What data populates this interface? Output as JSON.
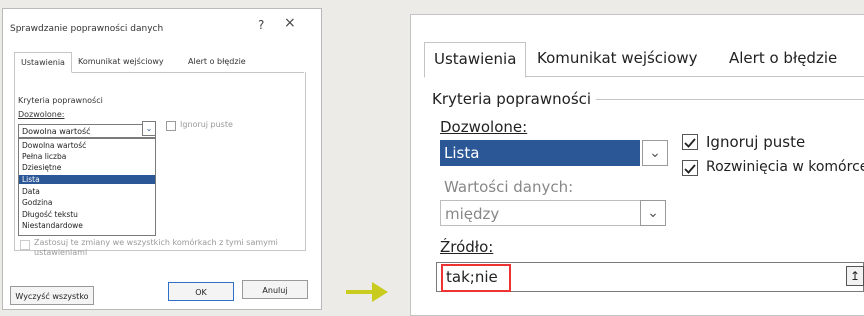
{
  "small_dialog": {
    "title": "Sprawdzanie poprawności danych",
    "help": "?",
    "close": "×",
    "tabs": [
      "Ustawienia",
      "Komunikat wejściowy",
      "Alert o błędzie"
    ],
    "criteria_label": "Kryteria poprawności",
    "allow_label": "Dozwolone:",
    "allow_value": "Dowolna wartość",
    "ignore_blank_label": "Ignoruj puste",
    "options": [
      "Dowolna wartość",
      "Pełna liczba",
      "Dziesiętne",
      "Lista",
      "Data",
      "Godzina",
      "Długość tekstu",
      "Niestandardowe"
    ],
    "selected_option": "Lista",
    "apply_changes": "Zastosuj te zmiany we wszystkich komórkach z tymi samymi ustawieniami",
    "clear_all": "Wyczyść wszystko",
    "ok": "OK",
    "cancel": "Anuluj"
  },
  "zoomed_dialog": {
    "tabs": [
      "Ustawienia",
      "Komunikat wejściowy",
      "Alert o błędzie"
    ],
    "criteria_label": "Kryteria poprawności",
    "allow_label": "Dozwolone:",
    "allow_value": "Lista",
    "ignore_blank_label": "Ignoruj puste",
    "in_cell_dropdown_label": "Rozwinięcia w komórce",
    "data_label": "Wartości danych:",
    "data_value": "między",
    "source_label": "Źródło:",
    "source_value": "tak;nie",
    "collapse_icon": "↥"
  },
  "colors": {
    "selection": "#2b5797",
    "arrow": "#c9cc1e",
    "highlight": "#ee3333"
  }
}
